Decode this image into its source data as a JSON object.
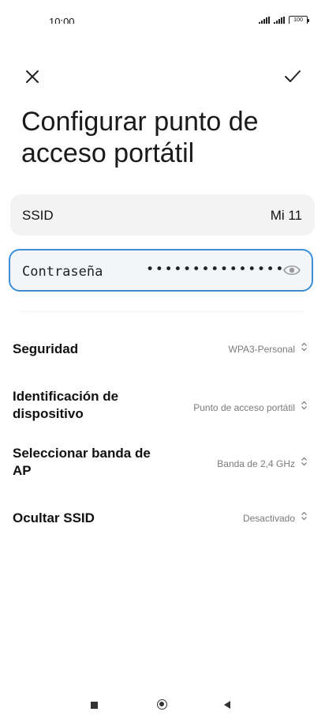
{
  "status_bar": {
    "time": "10:00",
    "battery": "100"
  },
  "header": {
    "title": "Configurar punto de acceso portátil"
  },
  "ssid": {
    "label": "SSID",
    "value": "Mi 11"
  },
  "password": {
    "label": "Contraseña",
    "masked_value": "•••••••••••••••"
  },
  "settings": [
    {
      "label": "Seguridad",
      "value": "WPA3-Personal"
    },
    {
      "label": "Identificación de dispositivo",
      "value": "Punto de acceso portátil"
    },
    {
      "label": "Seleccionar banda de AP",
      "value": "Banda de 2,4 GHz"
    },
    {
      "label": "Ocultar SSID",
      "value": "Desactivado"
    }
  ],
  "icons": {
    "close": "close-icon",
    "confirm": "check-icon",
    "password_visibility": "eye-icon",
    "selector": "updown-chevron-icon"
  },
  "colors": {
    "focus_border": "#3a8fd6",
    "card_bg": "#f3f3f3",
    "secondary_text": "#7a7a7a"
  }
}
